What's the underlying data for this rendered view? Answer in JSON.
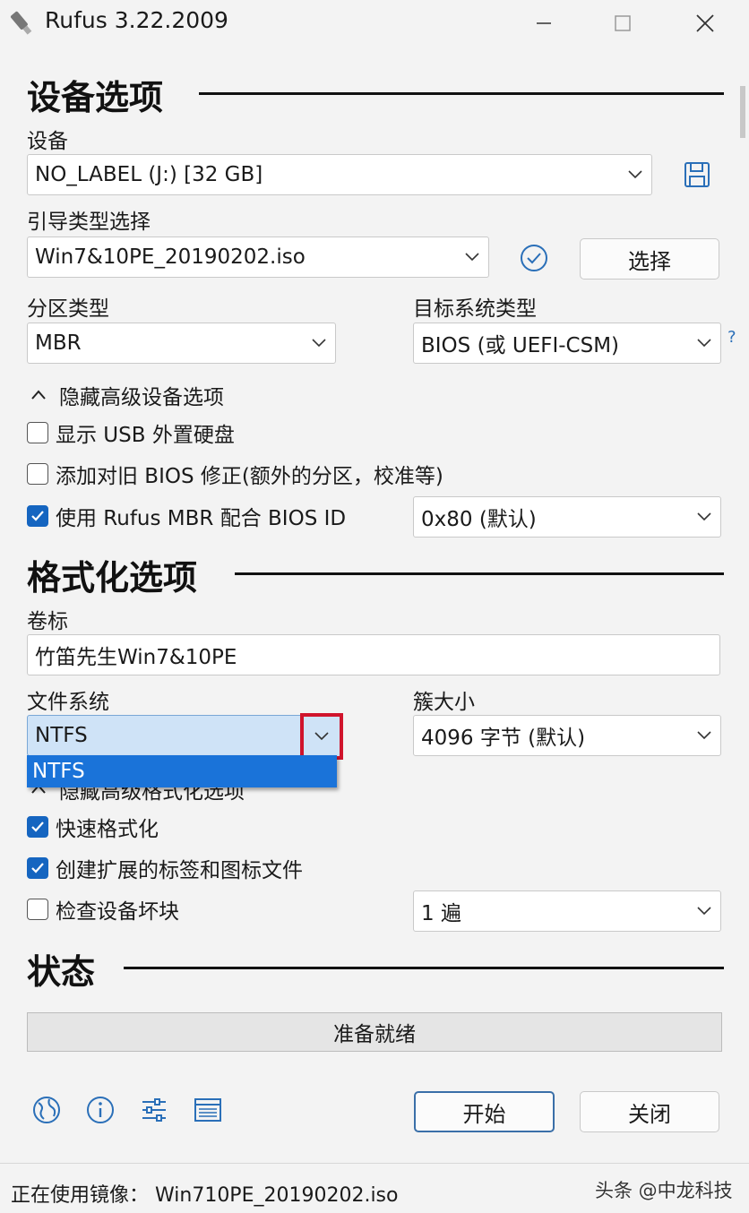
{
  "window": {
    "title": "Rufus 3.22.2009",
    "minimize_icon": "minimize-icon",
    "maximize_icon": "maximize-icon",
    "close_icon": "close-icon"
  },
  "device_options": {
    "heading": "设备选项",
    "device_label": "设备",
    "device_value": "NO_LABEL (J:) [32 GB]",
    "boot_label": "引导类型选择",
    "boot_value": "Win7&10PE_20190202.iso",
    "select_button": "选择",
    "partition_label": "分区类型",
    "partition_value": "MBR",
    "target_label": "目标系统类型",
    "target_value": "BIOS (或 UEFI-CSM)",
    "help": "?",
    "advanced_toggle": "隐藏高级设备选项",
    "show_usb": "显示 USB 外置硬盘",
    "old_bios": "添加对旧 BIOS 修正(额外的分区，校准等)",
    "rufus_mbr": "使用 Rufus MBR 配合 BIOS ID",
    "bios_id_value": "0x80 (默认)"
  },
  "format_options": {
    "heading": "格式化选项",
    "volume_label": "卷标",
    "volume_value": "竹笛先生Win7&10PE",
    "fs_label": "文件系统",
    "fs_value": "NTFS",
    "fs_dropdown_option": "NTFS",
    "cluster_label": "簇大小",
    "cluster_value": "4096 字节 (默认)",
    "advanced_toggle": "隐藏高级格式化选项",
    "quick_format": "快速格式化",
    "extended_label": "创建扩展的标签和图标文件",
    "bad_blocks": "检查设备坏块",
    "passes_value": "1 遍"
  },
  "status": {
    "heading": "状态",
    "progress_text": "准备就绪",
    "progress": 0
  },
  "footer": {
    "start_button": "开始",
    "close_button": "关闭",
    "status_line": "正在使用镜像： Win710PE_20190202.iso",
    "watermark": "头条 @中龙科技"
  },
  "colors": {
    "accent": "#1565c0",
    "highlight_box": "#d0142c",
    "dropdown_selected": "#1a73d9"
  }
}
